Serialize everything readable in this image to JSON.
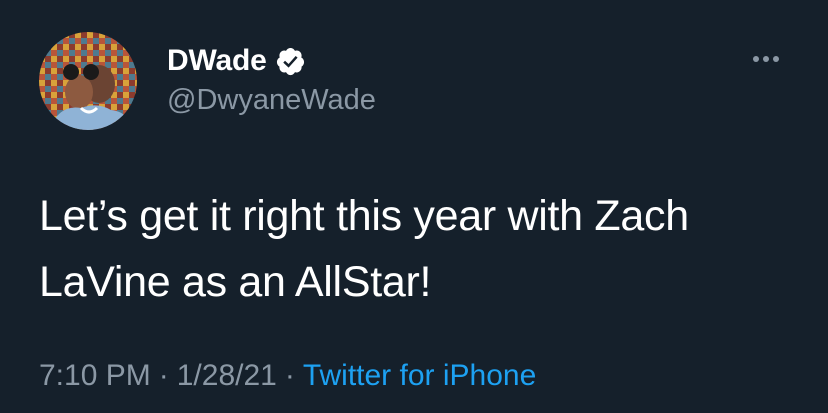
{
  "tweet": {
    "display_name": "DWade",
    "handle": "@DwyaneWade",
    "verified": true,
    "avatar_icon": "profile-photo",
    "more_icon": "ellipsis-icon",
    "text_line1": "Let’s get it right this year with Zach",
    "text_line2": "LaVine as an AllStar!",
    "time": "7:10 PM",
    "separator": "·",
    "date": "1/28/21",
    "source": "Twitter for iPhone"
  },
  "colors": {
    "background": "#15202b",
    "primary_text": "#ffffff",
    "secondary_text": "#8b98a5",
    "link": "#1da1f2"
  }
}
